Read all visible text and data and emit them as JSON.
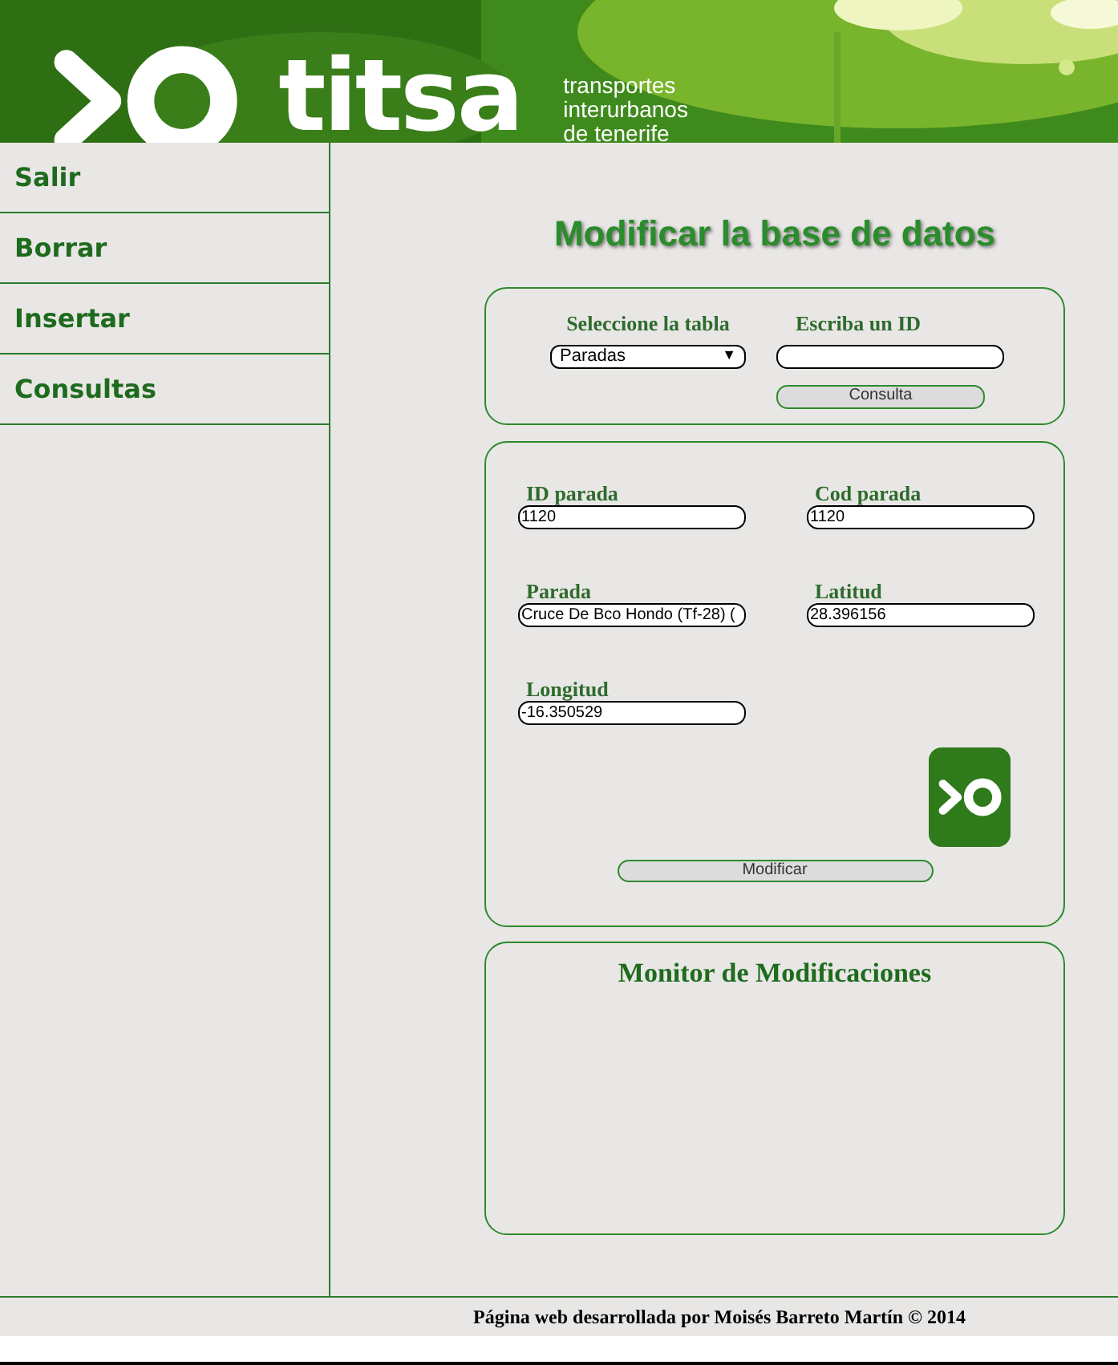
{
  "banner": {
    "brand": "titsa",
    "tagline": [
      "transportes",
      "interurbanos",
      "de tenerife"
    ]
  },
  "sidebar": {
    "items": [
      {
        "label": "Salir"
      },
      {
        "label": "Borrar"
      },
      {
        "label": "Insertar"
      },
      {
        "label": "Consultas"
      }
    ]
  },
  "title": "Modificar la base de datos",
  "query": {
    "table_label": "Seleccione la tabla",
    "table_value": "Paradas",
    "arrow": "▼",
    "id_label": "Escriba un ID",
    "button": "Consulta"
  },
  "form": {
    "fields": [
      {
        "label": "ID parada",
        "value": "1120"
      },
      {
        "label": "Cod parada",
        "value": "1120"
      },
      {
        "label": "Parada",
        "value": "Cruce De Bco Hondo (Tf-28) ("
      },
      {
        "label": "Latitud",
        "value": "28.396156"
      },
      {
        "label": "Longitud",
        "value": "-16.350529"
      }
    ],
    "button": "Modificar"
  },
  "monitor": {
    "title": "Monitor de Modificaciones"
  },
  "footer": "Página web desarrollada por Moisés Barreto Martín © 2014"
}
